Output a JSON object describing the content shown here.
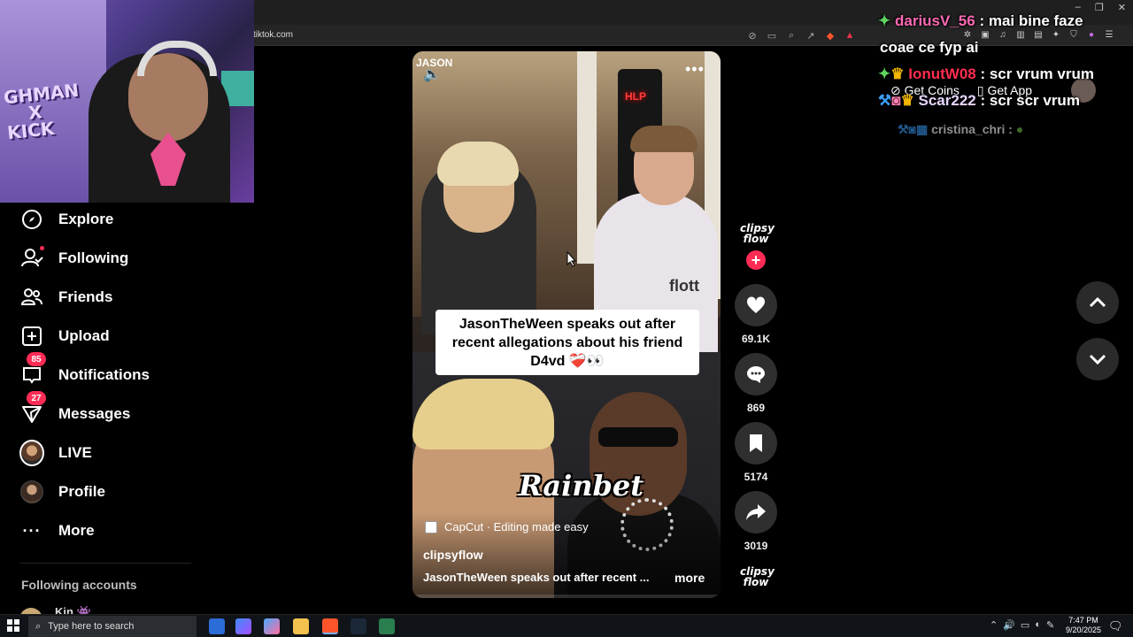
{
  "browser": {
    "url": "tiktok.com"
  },
  "webcam": {
    "overlay_text": "CHMAN\nX\nKICK"
  },
  "sidebar": {
    "items": [
      {
        "label": "Explore",
        "icon": "compass-icon"
      },
      {
        "label": "Following",
        "icon": "following-icon"
      },
      {
        "label": "Friends",
        "icon": "friends-icon"
      },
      {
        "label": "Upload",
        "icon": "upload-icon"
      },
      {
        "label": "Notifications",
        "icon": "notifications-icon",
        "badge": "85"
      },
      {
        "label": "Messages",
        "icon": "messages-icon",
        "badge": "27"
      },
      {
        "label": "LIVE",
        "icon": "live-avatar"
      },
      {
        "label": "Profile",
        "icon": "profile-avatar"
      },
      {
        "label": "More",
        "icon": "more-icon"
      }
    ],
    "following_heading": "Following accounts",
    "following_first": "Kin"
  },
  "video": {
    "watermark": "JASON",
    "caption_lines": [
      "JasonTheWeen speaks out after",
      "recent allegations about his friend",
      "D4vd ❤️‍🩹👀"
    ],
    "sponsor": "Rainbet",
    "effect": "CapCut · Editing made easy",
    "author": "clipsyflow",
    "description": "JasonTheWeen speaks out after recent ...",
    "more": "more",
    "sign_hlp": "HLP",
    "shirt_text": "flott"
  },
  "actions": {
    "profile_name": "clipsy flow",
    "likes": "69.1K",
    "comments": "869",
    "saves": "5174",
    "shares": "3019"
  },
  "header_actions": {
    "get_coins": "Get Coins",
    "get_app": "Get App"
  },
  "chat": {
    "messages": [
      {
        "user": "dariusV_56",
        "text": ": mai bine faze",
        "user_color": "#ff69b4"
      },
      {
        "user": "",
        "text": "coae ce fyp ai",
        "user_color": "#ffffff"
      },
      {
        "user": "IonutW08",
        "text": ": scr vrum vrum",
        "user_color": "#ff2d4f"
      },
      {
        "user": "Scar222",
        "text": ": scr scr vrum",
        "user_color": "#e7d6ff"
      },
      {
        "user": "cristina_chri",
        "text": ":",
        "user_color": "#9aa"
      }
    ]
  },
  "taskbar": {
    "search_placeholder": "Type here to search",
    "time": "7:47 PM",
    "date": "9/20/2025"
  },
  "colors": {
    "accent": "#fe2c55",
    "bg": "#000000",
    "action_bg": "#2f2f2f"
  }
}
